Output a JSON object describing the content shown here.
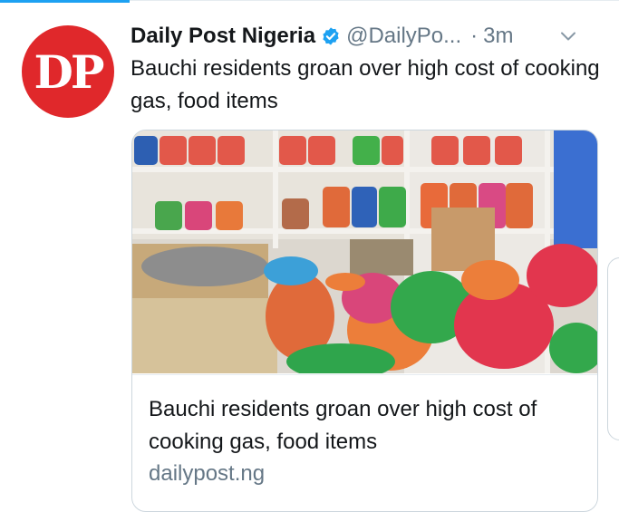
{
  "tweet": {
    "author_name": "Daily Post Nigeria",
    "author_handle": "@DailyPo...",
    "time_separator": "·",
    "timestamp": "3m",
    "avatar_text": "DP",
    "text": "Bauchi residents groan over high cost of cooking gas, food items",
    "icons": {
      "verified": "verified-badge-icon",
      "menu": "chevron-down-icon"
    }
  },
  "card": {
    "title": "Bauchi residents groan over high cost of cooking gas, food items",
    "domain": "dailypost.ng"
  },
  "colors": {
    "accent": "#1da1f2",
    "avatar_bg": "#e0282b",
    "text_primary": "#14171a",
    "text_secondary": "#657786",
    "border": "#ccd6dd"
  }
}
